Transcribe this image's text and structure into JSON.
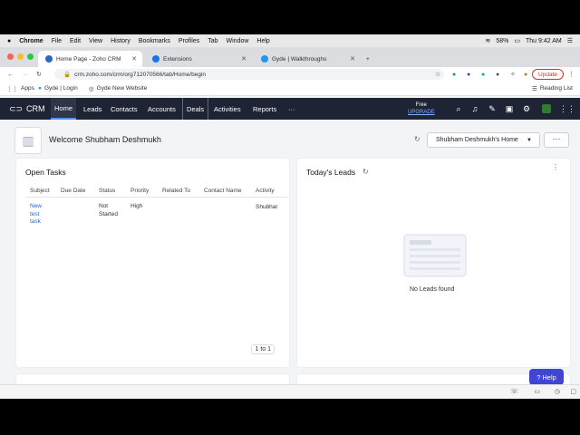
{
  "macos": {
    "app": "Chrome",
    "menus": [
      "File",
      "Edit",
      "View",
      "History",
      "Bookmarks",
      "Profiles",
      "Tab",
      "Window",
      "Help"
    ],
    "battery": "58%",
    "clock": "Thu 9:42 AM"
  },
  "browser": {
    "tabs": [
      {
        "label": "Home Page - Zoho CRM"
      },
      {
        "label": "Extensions"
      },
      {
        "label": "Gyde | Walkthroughs"
      }
    ],
    "new_tab": "+",
    "url": "crm.zoho.com/crm/org712070566/tab/Home/begin",
    "update_label": "Update",
    "bookmarks": [
      "Apps",
      "Gyde | Login",
      "Gyde New Website"
    ],
    "reading_list": "Reading List"
  },
  "crm": {
    "brand": "CRM",
    "nav": [
      "Home",
      "Leads",
      "Contacts",
      "Accounts",
      "Deals",
      "Activities",
      "Reports",
      "···"
    ],
    "plan": "Free",
    "upgrade": "UPGRADE"
  },
  "welcome": {
    "title": "Welcome Shubham Deshmukh",
    "home_selector": "Shubham Deshmukh's Home",
    "more": "···"
  },
  "open_tasks": {
    "title": "Open Tasks",
    "columns": [
      "Subject",
      "Due Date",
      "Status",
      "Priority",
      "Related To",
      "Contact Name",
      "Activity"
    ],
    "row": {
      "subject": [
        "New",
        "test",
        "task"
      ],
      "status": [
        "Not",
        "Started"
      ],
      "priority": "High",
      "activity": "Shubhar"
    },
    "pager": "1 to 1"
  },
  "todays_leads": {
    "title": "Today's Leads",
    "empty": "No Leads found"
  },
  "help": "Help",
  "colors": {
    "nav_bg": "#1e2433",
    "accent": "#3f46d6",
    "link": "#2b66c9",
    "update": "#d93025"
  }
}
